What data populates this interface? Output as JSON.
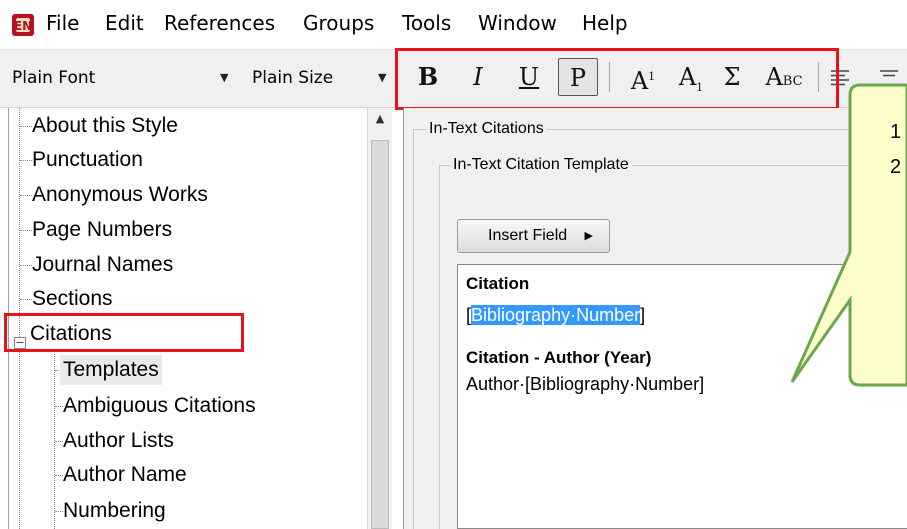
{
  "menubar": {
    "logo_icon": "endnote-logo-icon",
    "items": [
      "File",
      "Edit",
      "References",
      "Groups",
      "Tools",
      "Window",
      "Help"
    ]
  },
  "toolbar": {
    "font_combo": "Plain Font",
    "size_combo": "Plain Size",
    "bold_label": "B",
    "italic_label": "I",
    "underline_label": "U",
    "plain_label": "P",
    "superscript_label": "A",
    "superscript_mark": "1",
    "subscript_label": "A",
    "subscript_mark": "1",
    "symbol_label": "Σ",
    "smallcaps_label": "A",
    "smallcaps_mark": "BC",
    "align_icon": "align-left-icon",
    "highlight_color": "#e8141c"
  },
  "tree": {
    "items": [
      "About this Style",
      "Punctuation",
      "Anonymous Works",
      "Page Numbers",
      "Journal Names",
      "Sections",
      "Citations",
      "Templates",
      "Ambiguous Citations",
      "Author Lists",
      "Author Name",
      "Numbering"
    ],
    "expander": "−"
  },
  "panel": {
    "group_label": "In-Text Citations",
    "subgroup_label": "In-Text Citation Template",
    "insert_button": "Insert Field",
    "editor": {
      "heading1": "Citation",
      "line1_open": "[",
      "line1_selected": "Bibliography·Number",
      "line1_close": "]",
      "heading2": "Citation - Author (Year)",
      "line2": "Author·[Bibliography·Number]"
    },
    "selection_color": "#3399ff"
  },
  "callout": {
    "line1": "1",
    "line2": "2",
    "fill": "#ffffcc",
    "stroke": "#6aa84f"
  }
}
